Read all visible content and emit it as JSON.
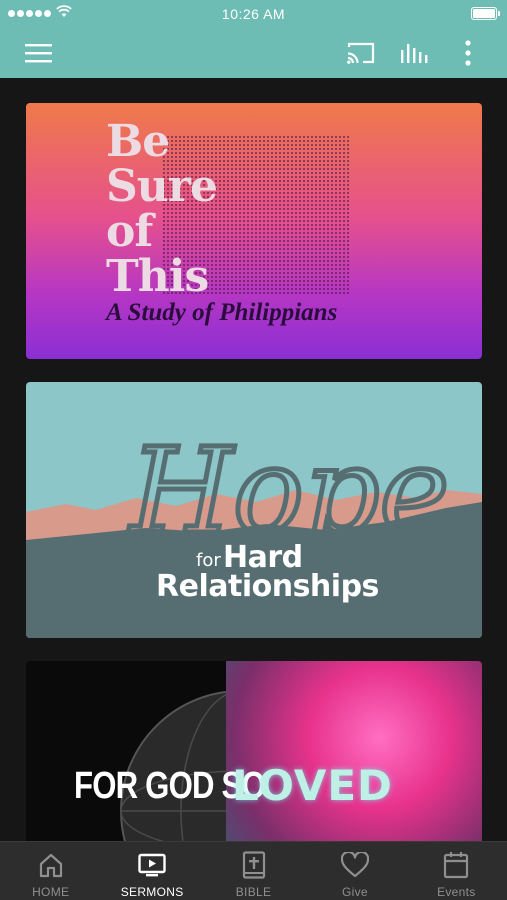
{
  "status_bar": {
    "time": "10:26 AM",
    "signal_icon": "signal-dots-icon",
    "wifi_icon": "wifi-icon",
    "battery_icon": "battery-icon"
  },
  "app_bar": {
    "background": "#6dbdb5",
    "menu_icon": "hamburger-menu-icon",
    "cast_icon": "cast-icon",
    "audio_icon": "audio-bars-icon",
    "more_icon": "more-vertical-icon"
  },
  "sermons": [
    {
      "title_lines": [
        "Be",
        "Sure",
        "of",
        "This"
      ],
      "subtitle": "A Study of Philippians"
    },
    {
      "script_title": "Hope",
      "for": "for",
      "line1": "Hard",
      "line2": "Relationships"
    },
    {
      "part1": "FOR GOD SO",
      "part2": "LOVED"
    }
  ],
  "tab_bar": {
    "active": "SERMONS",
    "tabs": [
      {
        "label": "HOME",
        "icon": "home-icon"
      },
      {
        "label": "SERMONS",
        "icon": "tv-play-icon"
      },
      {
        "label": "BIBLE",
        "icon": "bible-icon"
      },
      {
        "label": "Give",
        "icon": "heart-icon"
      },
      {
        "label": "Events",
        "icon": "calendar-icon"
      }
    ]
  }
}
